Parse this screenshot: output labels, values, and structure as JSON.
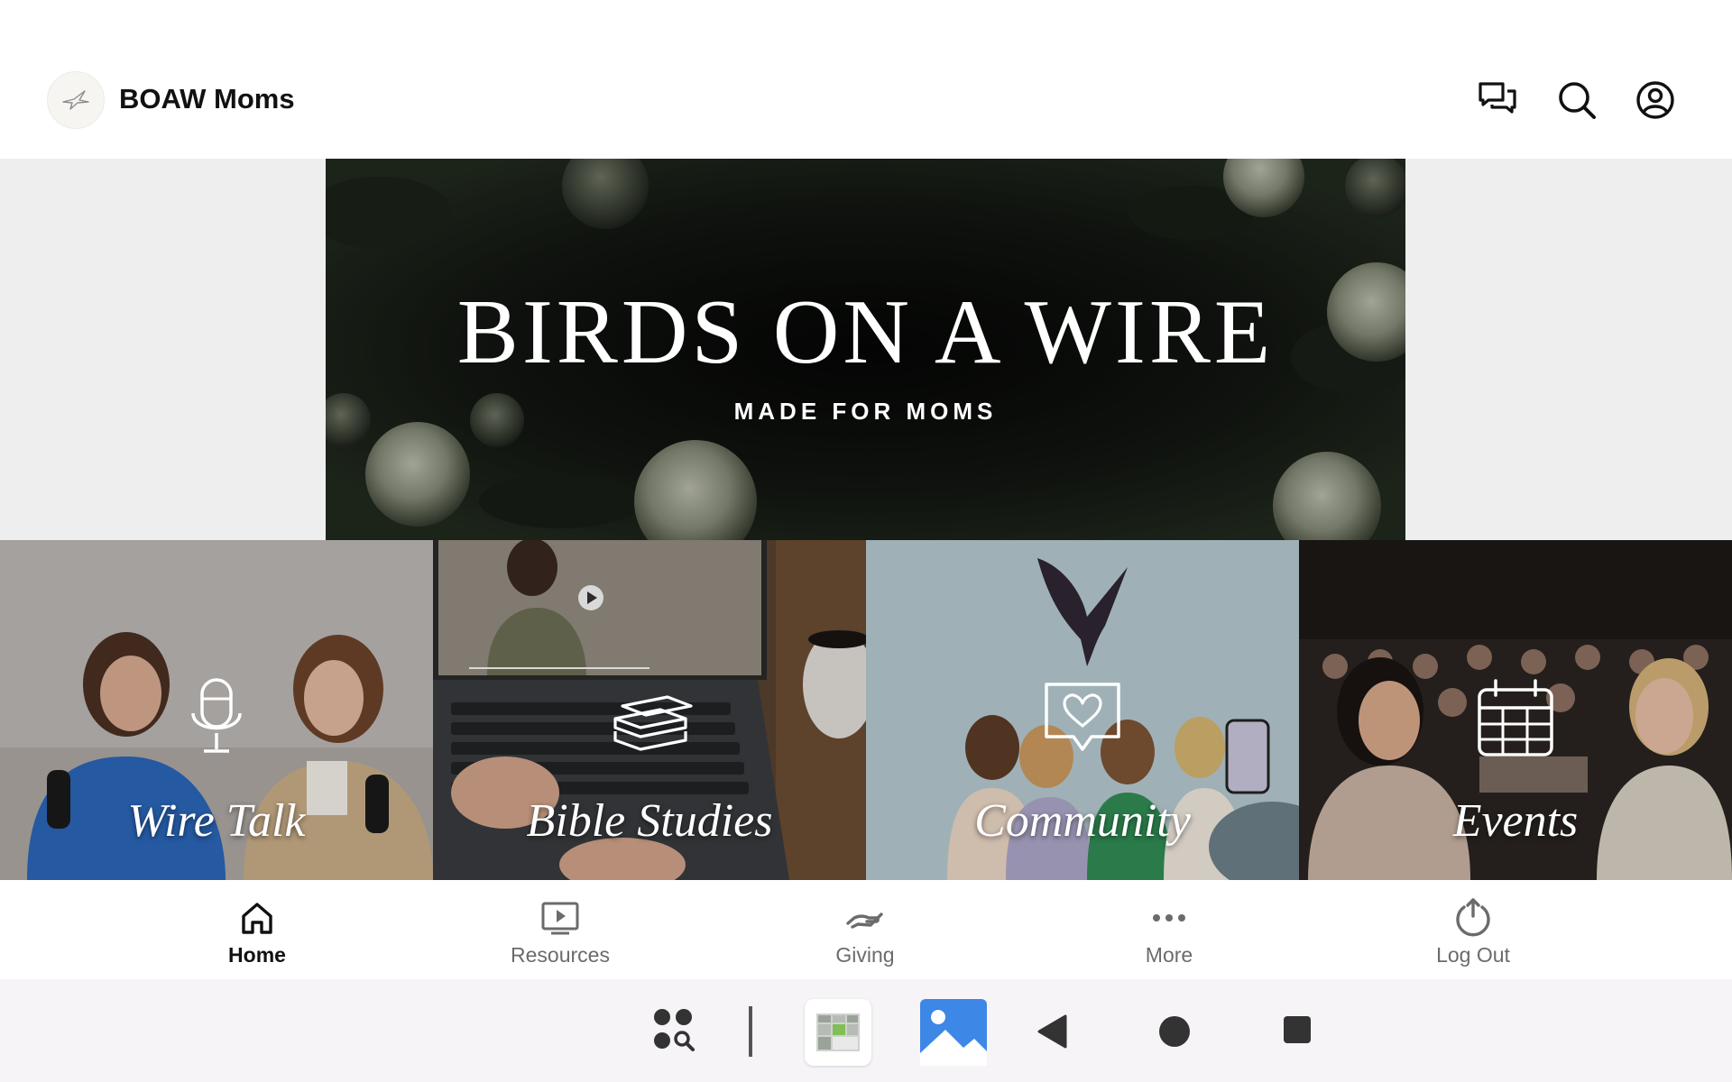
{
  "header": {
    "app_name": "BOAW Moms",
    "icons": [
      "bird-logo-icon",
      "chat-icon",
      "search-icon",
      "account-icon"
    ]
  },
  "hero": {
    "title": "BIRDS ON A WIRE",
    "subtitle": "MADE FOR MOMS"
  },
  "tiles": [
    {
      "label": "Wire Talk",
      "icon": "microphone-icon"
    },
    {
      "label": "Bible Studies",
      "icon": "books-icon"
    },
    {
      "label": "Community",
      "icon": "heart-chat-icon"
    },
    {
      "label": "Events",
      "icon": "calendar-icon"
    }
  ],
  "bottom_nav": {
    "items": [
      {
        "label": "Home",
        "icon": "home-icon",
        "active": true
      },
      {
        "label": "Resources",
        "icon": "play-screen-icon",
        "active": false
      },
      {
        "label": "Giving",
        "icon": "giving-hand-icon",
        "active": false
      },
      {
        "label": "More",
        "icon": "more-dots-icon",
        "active": false
      },
      {
        "label": "Log Out",
        "icon": "power-icon",
        "active": false
      }
    ]
  },
  "system_bar": {
    "icons": [
      "app-search-icon",
      "calendar-app-icon",
      "gallery-app-icon",
      "back-icon",
      "home-circle-icon",
      "recents-icon"
    ]
  },
  "colors": {
    "text_primary": "#111111",
    "text_secondary": "#6b6b6b",
    "hero_background": "#111310",
    "system_bar": "#f7f4f8"
  }
}
